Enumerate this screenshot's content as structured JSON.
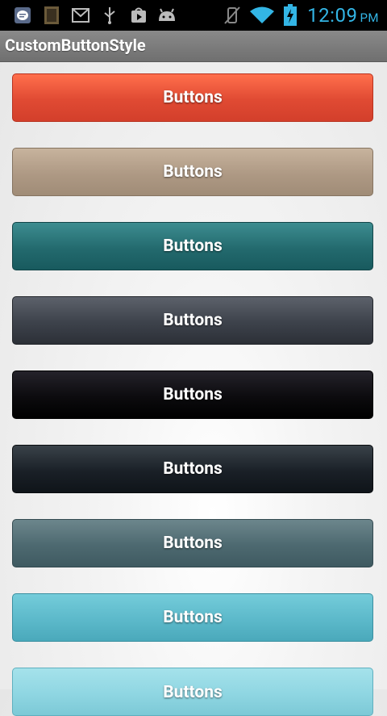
{
  "status_bar": {
    "time": "12:09",
    "ampm": "PM",
    "icons": [
      "chat-icon",
      "book-icon",
      "gmail-icon",
      "usb-icon",
      "play-store-icon",
      "android-icon",
      "vibrate-mute-icon",
      "wifi-icon",
      "battery-charging-icon"
    ],
    "accent": "#33b5e5"
  },
  "app": {
    "title": "CustomButtonStyle"
  },
  "buttons": [
    {
      "label": "Buttons",
      "color": "#e54a33"
    },
    {
      "label": "Buttons",
      "color": "#b09c87"
    },
    {
      "label": "Buttons",
      "color": "#246b6f"
    },
    {
      "label": "Buttons",
      "color": "#3d424b"
    },
    {
      "label": "Buttons",
      "color": "#0c0b0e"
    },
    {
      "label": "Buttons",
      "color": "#1a2027"
    },
    {
      "label": "Buttons",
      "color": "#4d6970"
    },
    {
      "label": "Buttons",
      "color": "#5cb9ca"
    },
    {
      "label": "Buttons",
      "color": "#8fd6e2"
    }
  ]
}
